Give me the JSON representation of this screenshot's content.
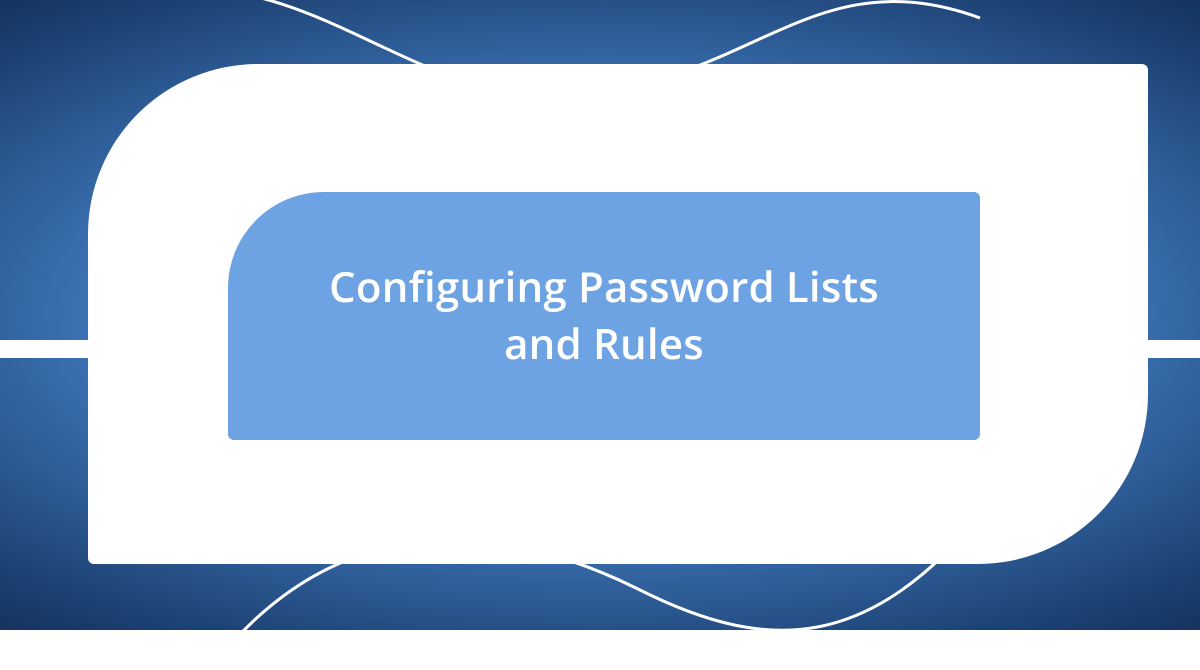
{
  "title": "Configuring Password Lists and Rules",
  "colors": {
    "innerPanel": "#6da3e2",
    "outerPanel": "#ffffff",
    "text": "#ffffff"
  }
}
